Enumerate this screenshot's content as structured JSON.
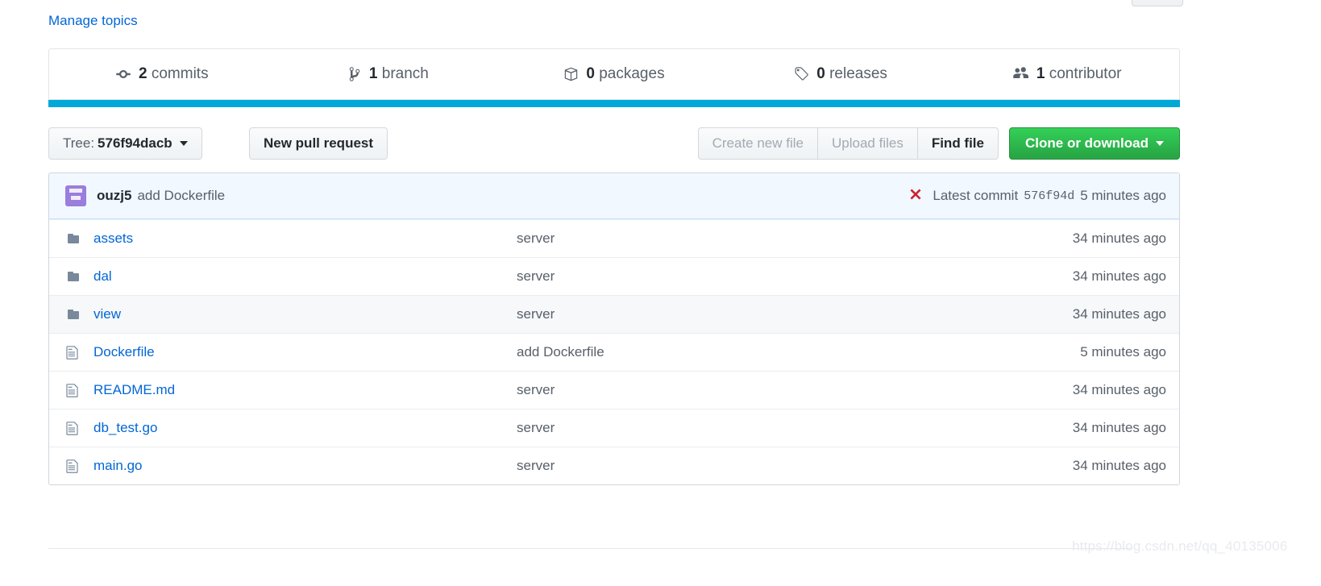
{
  "topics": {
    "manage_label": "Manage topics"
  },
  "stats": [
    {
      "icon": "commit-icon",
      "count": "2",
      "label": "commits",
      "name": "stat-commits"
    },
    {
      "icon": "branch-icon",
      "count": "1",
      "label": "branch",
      "name": "stat-branches"
    },
    {
      "icon": "package-icon",
      "count": "0",
      "label": "packages",
      "name": "stat-packages"
    },
    {
      "icon": "tag-icon",
      "count": "0",
      "label": "releases",
      "name": "stat-releases"
    },
    {
      "icon": "people-icon",
      "count": "1",
      "label": "contributor",
      "name": "stat-contributors"
    }
  ],
  "loading_bar_color": "#00a9d8",
  "toolbar": {
    "tree_prefix": "Tree:",
    "tree_ref": "576f94dacb",
    "new_pull_request": "New pull request",
    "create_new_file": "Create new file",
    "upload_files": "Upload files",
    "find_file": "Find file",
    "clone_or_download": "Clone or download",
    "clone_button_color": "#28a745"
  },
  "commit_header": {
    "author": "ouzj5",
    "message": "add Dockerfile",
    "status_icon": "x-icon",
    "status_color": "#cb2431",
    "latest_commit_label": "Latest commit",
    "sha": "576f94d",
    "age": "5 minutes ago"
  },
  "files": [
    {
      "type": "folder",
      "icon": "folder-icon",
      "name": "assets",
      "message": "server",
      "age": "34 minutes ago",
      "hover": false
    },
    {
      "type": "folder",
      "icon": "folder-icon",
      "name": "dal",
      "message": "server",
      "age": "34 minutes ago",
      "hover": false
    },
    {
      "type": "folder",
      "icon": "folder-icon",
      "name": "view",
      "message": "server",
      "age": "34 minutes ago",
      "hover": true
    },
    {
      "type": "file",
      "icon": "file-icon",
      "name": "Dockerfile",
      "message": "add Dockerfile",
      "age": "5 minutes ago",
      "hover": false
    },
    {
      "type": "file",
      "icon": "file-icon",
      "name": "README.md",
      "message": "server",
      "age": "34 minutes ago",
      "hover": false
    },
    {
      "type": "file",
      "icon": "file-icon",
      "name": "db_test.go",
      "message": "server",
      "age": "34 minutes ago",
      "hover": false
    },
    {
      "type": "file",
      "icon": "file-icon",
      "name": "main.go",
      "message": "server",
      "age": "34 minutes ago",
      "hover": false
    }
  ],
  "watermark": {
    "text": "https://blog.csdn.net/qq_40135006"
  }
}
